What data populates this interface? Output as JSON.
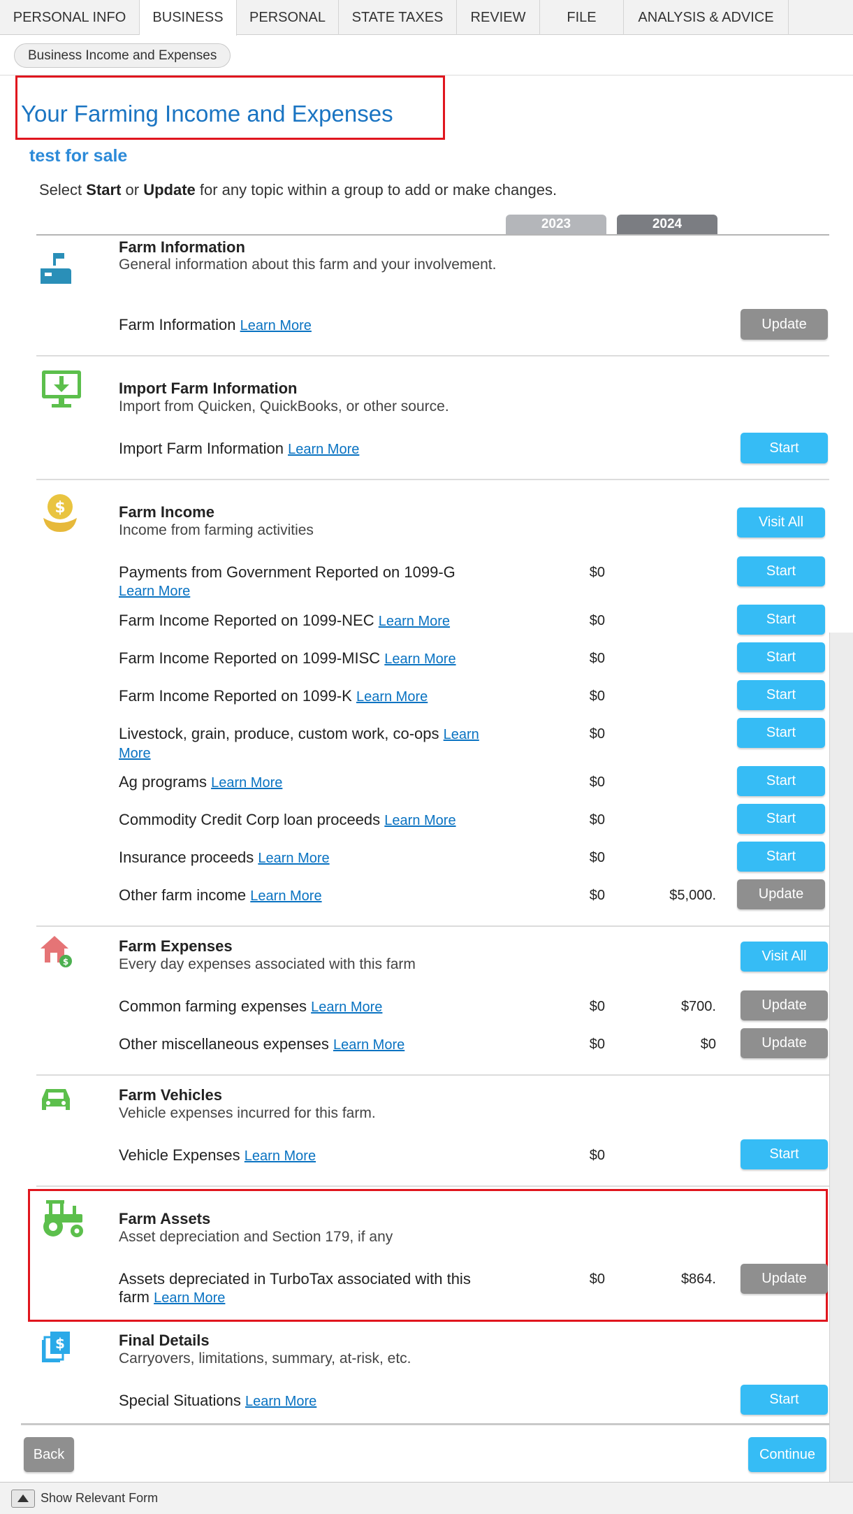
{
  "tabs": [
    "PERSONAL INFO",
    "BUSINESS",
    "PERSONAL",
    "STATE TAXES",
    "REVIEW",
    "FILE",
    "ANALYSIS & ADVICE"
  ],
  "breadcrumb": "Business Income and Expenses",
  "page_title": "Your Farming Income and Expenses",
  "farm_name": "test for sale",
  "instructions": {
    "select": "Select ",
    "start": "Start",
    "or": " or ",
    "update": "Update",
    "rest": " for any topic within a group to add or make changes."
  },
  "years": [
    "2023",
    "2024"
  ],
  "learn_more": "Learn More",
  "colors": {
    "accent_blue": "#36bcf5",
    "title_blue": "#1a74c2",
    "button_gray": "#8f8f8f",
    "highlight_red": "#e0161e"
  },
  "sections": {
    "farm_info": {
      "title": "Farm Information",
      "desc": "General information about this farm and your involvement.",
      "icon": "mailbox-icon",
      "row": {
        "label": "Farm Information",
        "button": "Update"
      }
    },
    "import": {
      "title": "Import Farm Information",
      "desc": "Import from Quicken, QuickBooks, or other source.",
      "icon": "download-monitor-icon",
      "row": {
        "label": "Import Farm Information",
        "button": "Start"
      }
    },
    "income": {
      "title": "Farm Income",
      "desc": "Income from farming activities",
      "icon": "money-bag-icon",
      "visit_all": "Visit All",
      "rows": [
        {
          "label": "Payments from Government Reported on 1099-G",
          "y2023": "$0",
          "y2024": "",
          "button": "Start"
        },
        {
          "label": "Farm Income Reported on 1099-NEC",
          "y2023": "$0",
          "y2024": "",
          "button": "Start"
        },
        {
          "label": "Farm Income Reported on 1099-MISC",
          "y2023": "$0",
          "y2024": "",
          "button": "Start"
        },
        {
          "label": "Farm Income Reported on 1099-K",
          "y2023": "$0",
          "y2024": "",
          "button": "Start"
        },
        {
          "label": "Livestock, grain, produce, custom work, co-ops",
          "y2023": "$0",
          "y2024": "",
          "button": "Start"
        },
        {
          "label": "Ag programs",
          "y2023": "$0",
          "y2024": "",
          "button": "Start"
        },
        {
          "label": "Commodity Credit Corp loan proceeds",
          "y2023": "$0",
          "y2024": "",
          "button": "Start"
        },
        {
          "label": "Insurance proceeds",
          "y2023": "$0",
          "y2024": "",
          "button": "Start"
        },
        {
          "label": "Other farm income",
          "y2023": "$0",
          "y2024": "$5,000.",
          "button": "Update"
        }
      ]
    },
    "expenses": {
      "title": "Farm Expenses",
      "desc": "Every day expenses associated with this farm",
      "icon": "house-dollar-icon",
      "visit_all": "Visit All",
      "rows": [
        {
          "label": "Common farming expenses",
          "y2023": "$0",
          "y2024": "$700.",
          "button": "Update"
        },
        {
          "label": "Other miscellaneous expenses",
          "y2023": "$0",
          "y2024": "$0",
          "button": "Update"
        }
      ]
    },
    "vehicles": {
      "title": "Farm Vehicles",
      "desc": "Vehicle expenses incurred for this farm.",
      "icon": "car-icon",
      "row": {
        "label": "Vehicle Expenses",
        "y2023": "$0",
        "button": "Start"
      }
    },
    "assets": {
      "title": "Farm Assets",
      "desc": "Asset depreciation and Section 179, if any",
      "icon": "tractor-icon",
      "row": {
        "label": "Assets depreciated in TurboTax associated with this farm",
        "y2023": "$0",
        "y2024": "$864.",
        "button": "Update"
      }
    },
    "final": {
      "title": "Final Details",
      "desc": "Carryovers, limitations, summary, at-risk, etc.",
      "icon": "documents-dollar-icon",
      "row": {
        "label": "Special Situations",
        "button": "Start"
      }
    }
  },
  "nav": {
    "back": "Back",
    "continue": "Continue"
  },
  "footer": {
    "label": "Show Relevant Form"
  }
}
